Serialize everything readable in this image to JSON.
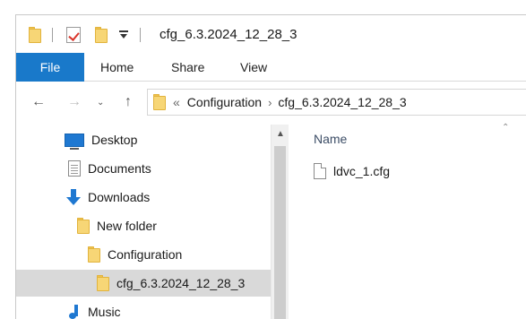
{
  "window": {
    "title": "cfg_6.3.2024_12_28_3"
  },
  "ribbon": {
    "tabs": [
      {
        "label": "File"
      },
      {
        "label": "Home"
      },
      {
        "label": "Share"
      },
      {
        "label": "View"
      }
    ]
  },
  "address": {
    "overflow": "«",
    "crumbs": [
      {
        "label": "Configuration"
      },
      {
        "label": "cfg_6.3.2024_12_28_3"
      }
    ],
    "separator": "›"
  },
  "navpane": {
    "items": [
      {
        "label": "Desktop",
        "icon": "desktop-icon"
      },
      {
        "label": "Documents",
        "icon": "documents-icon"
      },
      {
        "label": "Downloads",
        "icon": "downloads-icon"
      },
      {
        "label": "New folder",
        "icon": "folder-icon"
      },
      {
        "label": "Configuration",
        "icon": "folder-icon"
      },
      {
        "label": "cfg_6.3.2024_12_28_3",
        "icon": "folder-icon",
        "selected": true
      },
      {
        "label": "Music",
        "icon": "music-icon"
      }
    ]
  },
  "content": {
    "column_header": "Name",
    "files": [
      {
        "name": "ldvc_1.cfg",
        "icon": "file-icon"
      }
    ]
  },
  "colors": {
    "file_tab": "#1979ca",
    "folder": "#f7d676",
    "selected_row": "#d9d9d9"
  }
}
